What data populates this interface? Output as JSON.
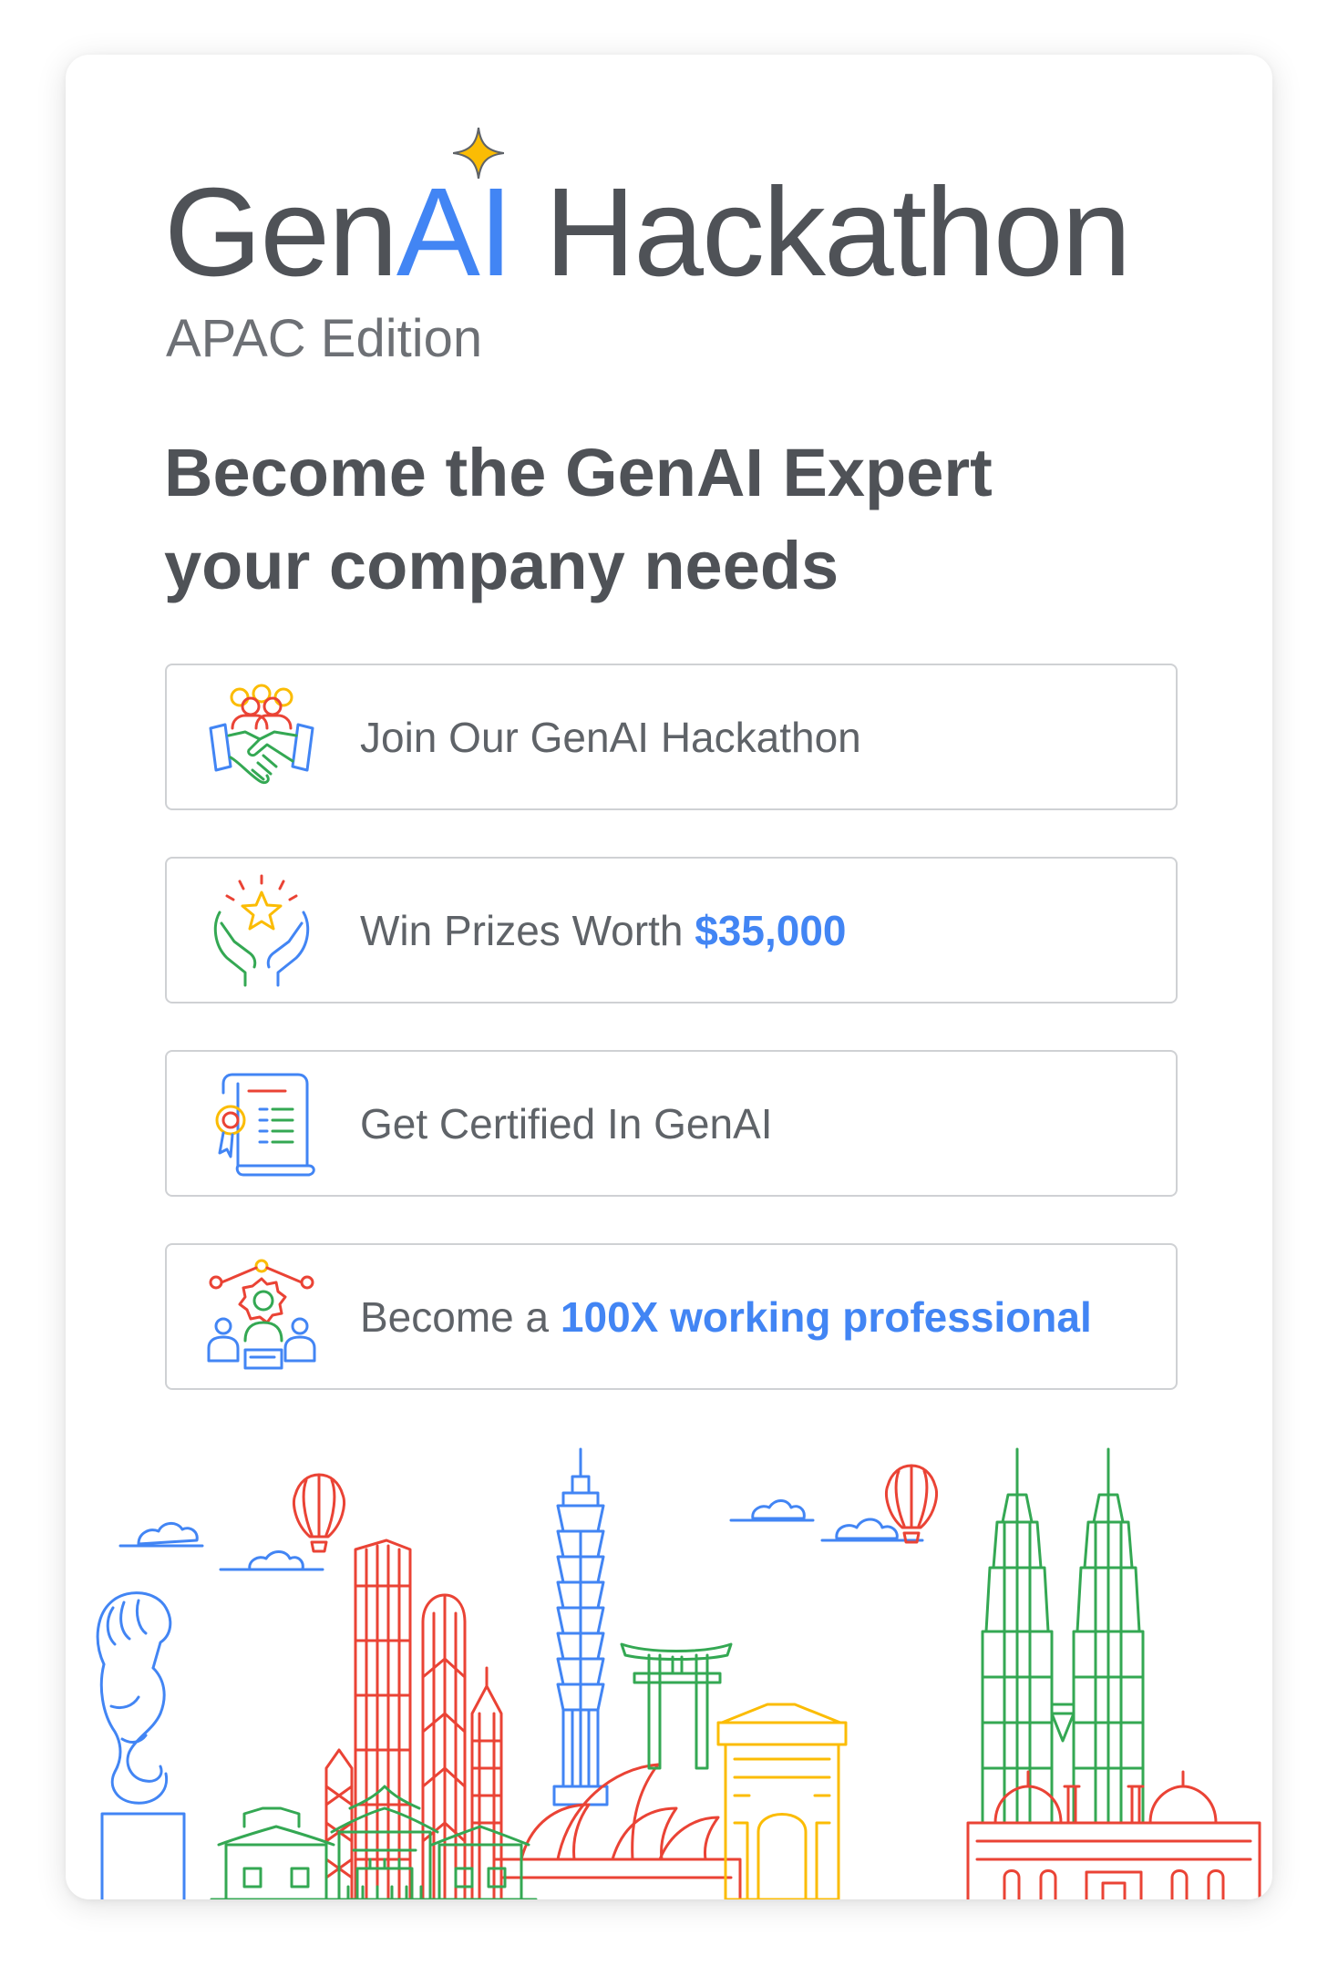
{
  "title": {
    "part1": "Gen",
    "part2": "AI",
    "part3": " Hackathon"
  },
  "subtitle": "APAC Edition",
  "headline": {
    "line1": "Become the GenAI Expert",
    "line2": "your company needs"
  },
  "features": [
    {
      "icon": "handshake-team-icon",
      "text": "Join Our GenAI Hackathon"
    },
    {
      "icon": "hands-star-icon",
      "text": "Win Prizes Worth ",
      "highlight": "$35,000"
    },
    {
      "icon": "certificate-icon",
      "text": "Get Certified In GenAI"
    },
    {
      "icon": "network-people-icon",
      "text": "Become a ",
      "highlight": "100X working professional"
    }
  ],
  "colors": {
    "blue": "#4285f4",
    "red": "#ea4335",
    "yellow": "#fbbc04",
    "green": "#34a853",
    "text": "#5f6368"
  }
}
